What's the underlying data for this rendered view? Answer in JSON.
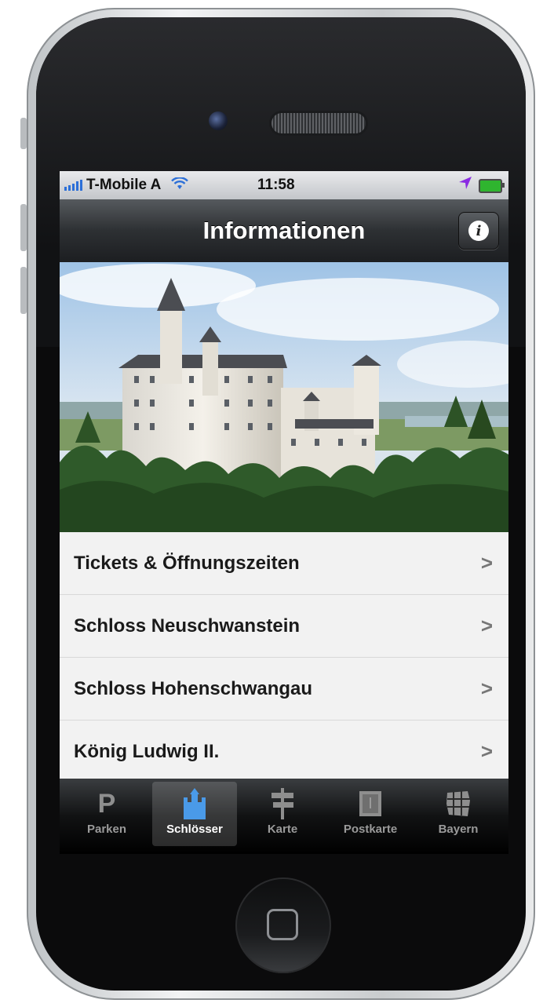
{
  "status_bar": {
    "carrier": "T-Mobile A",
    "time": "11:58",
    "icons": [
      "signal-icon",
      "wifi-icon",
      "location-arrow-icon",
      "battery-charging-icon"
    ]
  },
  "nav_bar": {
    "title": "Informationen",
    "info_button_icon": "info-icon",
    "info_glyph": "i"
  },
  "hero_image": {
    "subject": "castle-photo"
  },
  "menu": {
    "items": [
      {
        "label": "Tickets & Öffnungszeiten"
      },
      {
        "label": "Schloss Neuschwanstein"
      },
      {
        "label": "Schloss Hohenschwangau"
      },
      {
        "label": "König Ludwig II."
      }
    ],
    "chevron": ">"
  },
  "tab_bar": {
    "selected": "Schlösser",
    "tabs": [
      {
        "label": "Parken",
        "icon": "parking-icon",
        "glyph": "P"
      },
      {
        "label": "Schlösser",
        "icon": "castle-icon"
      },
      {
        "label": "Karte",
        "icon": "signpost-icon"
      },
      {
        "label": "Postkarte",
        "icon": "postcard-icon"
      },
      {
        "label": "Bayern",
        "icon": "bavaria-map-icon"
      }
    ]
  },
  "colors": {
    "accent_blue": "#2c6fd8",
    "nav_dark": "#2d3033",
    "list_bg": "#f2f2f2"
  }
}
